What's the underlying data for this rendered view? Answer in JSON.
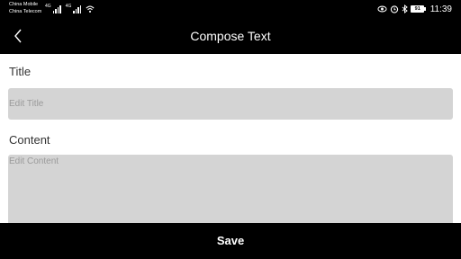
{
  "status_bar": {
    "carrier_1": "China Mobile",
    "carrier_2": "China Telecom",
    "network_1": "4G",
    "network_2": "4G",
    "battery_level": "91",
    "time": "11:39",
    "icons": [
      "signal-icon",
      "wifi-icon",
      "eye-icon",
      "alarm-icon",
      "bluetooth-icon",
      "battery-icon"
    ]
  },
  "app_bar": {
    "title": "Compose Text",
    "back_icon": "chevron-left-icon"
  },
  "form": {
    "title_label": "Title",
    "title_value": "",
    "title_placeholder": "Edit Title",
    "content_label": "Content",
    "content_value": "",
    "content_placeholder": "Edit Content"
  },
  "footer": {
    "save_label": "Save"
  },
  "colors": {
    "bar_background": "#000000",
    "input_background": "#d4d4d4",
    "page_background": "#ffffff"
  }
}
